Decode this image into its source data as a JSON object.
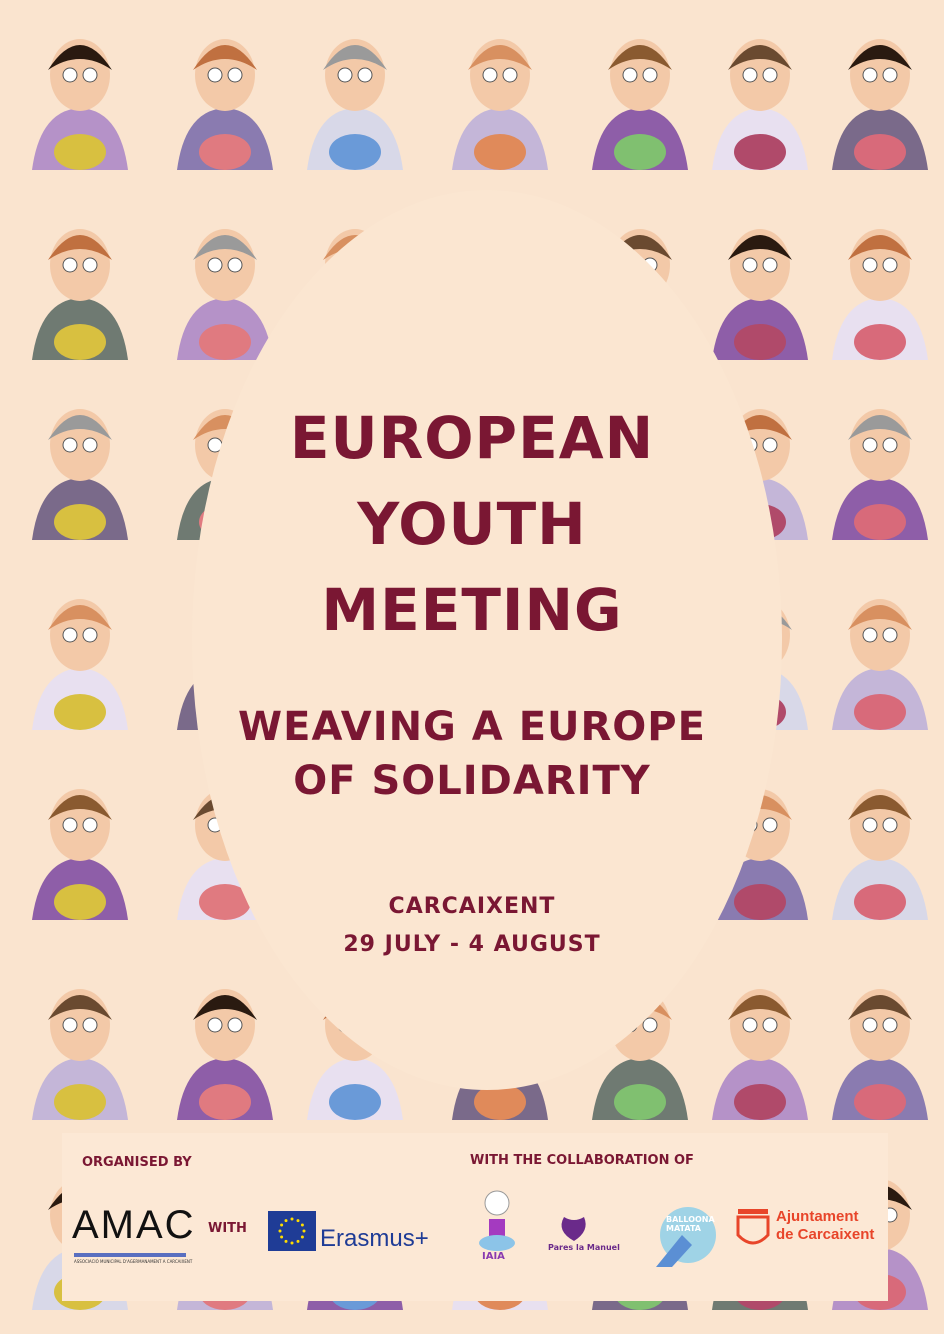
{
  "poster": {
    "title_lines": [
      "EUROPEAN",
      "YOUTH",
      "MEETING"
    ],
    "subtitle_lines": [
      "WEAVING A EUROPE",
      "OF SOLIDARITY"
    ],
    "location": "CARCAIXENT",
    "dates": "29 JULY - 4 AUGUST"
  },
  "footer": {
    "organised_label": "ORGANISED BY",
    "with_label": "WITH",
    "collab_label": "WITH THE COLLABORATION OF",
    "logos": {
      "amac": "AMAC",
      "amac_sub": "ASSOCIACIÓ MUNICIPAL D'AGERMANAMENT A CARCAIXENT",
      "erasmus": "Erasmus+",
      "iaia": "IAIA",
      "pares": "Pares la Manuel",
      "balloona": "BALLOONA MATATA",
      "ajuntament_1": "Ajuntament",
      "ajuntament_2": "de Carcaixent"
    }
  },
  "colors": {
    "background": "#fae4cf",
    "accent": "#7a1733",
    "ajuntament": "#e8452a",
    "erasmus": "#1f3c96"
  }
}
